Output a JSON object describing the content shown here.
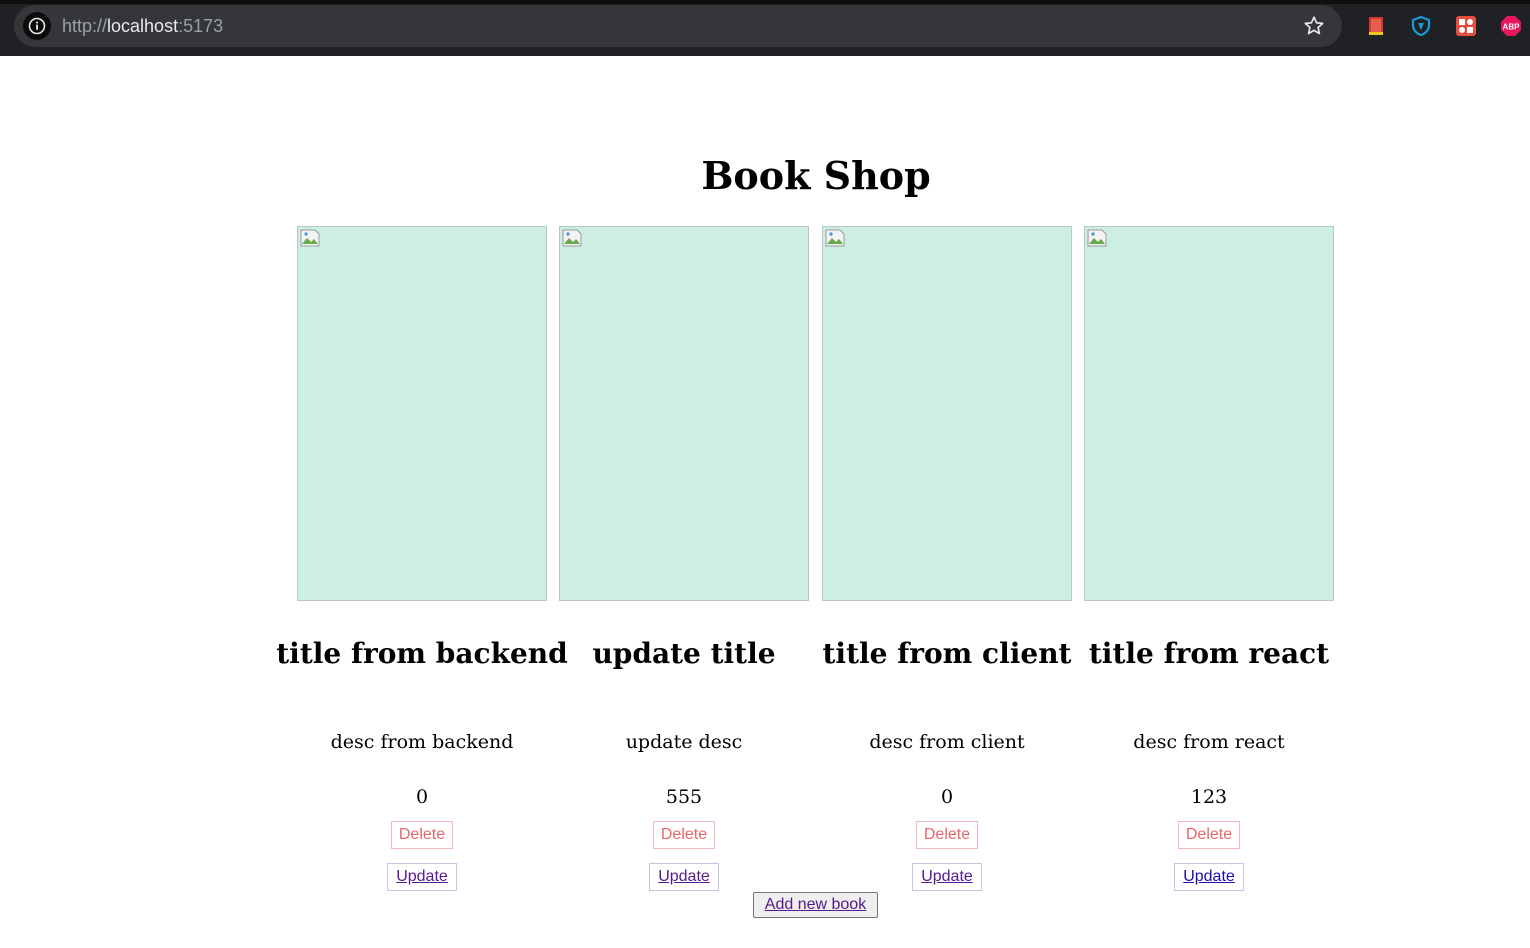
{
  "browser": {
    "url_scheme": "http://",
    "url_host": "localhost",
    "url_port": ":5173",
    "extensions": [
      "bookmark-extension-icon",
      "shield-vpn-extension-icon",
      "grid-extension-icon",
      "adblock-plus-icon"
    ],
    "adblock_label": "ABP"
  },
  "page": {
    "title": "Book Shop",
    "add_button_label": "Add new book"
  },
  "books": [
    {
      "title": "title from backend",
      "desc": "desc from backend",
      "price": "0",
      "delete_label": "Delete",
      "update_label": "Update"
    },
    {
      "title": "update title",
      "desc": "update desc",
      "price": "555",
      "delete_label": "Delete",
      "update_label": "Update"
    },
    {
      "title": "title from client",
      "desc": "desc from client",
      "price": "0",
      "delete_label": "Delete",
      "update_label": "Update"
    },
    {
      "title": "title from react",
      "desc": "desc from react",
      "price": "123",
      "delete_label": "Delete",
      "update_label": "Update"
    }
  ],
  "colors": {
    "image_placeholder": "#cdeee2",
    "delete_text": "#e8656a",
    "visited_link": "#551a8b",
    "link": "#1a0dab"
  }
}
